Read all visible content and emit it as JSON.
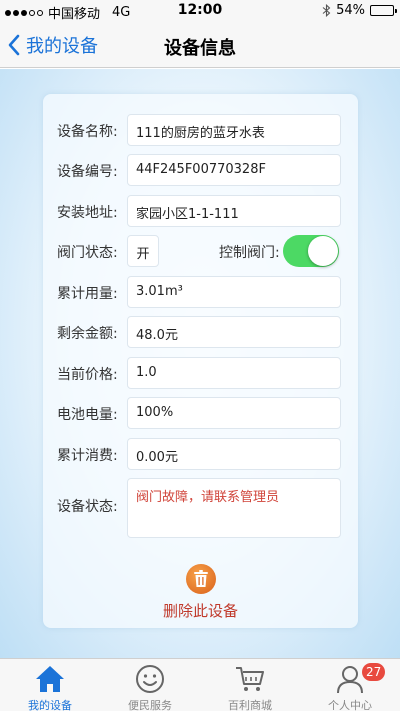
{
  "status_bar": {
    "carrier": "中国移动",
    "network": "4G",
    "time": "12:00",
    "battery_text": "54%",
    "battery_level": 0.54
  },
  "nav": {
    "back_label": "我的设备",
    "title": "设备信息"
  },
  "device": {
    "name_label": "设备名称:",
    "name_value": "111的厨房的蓝牙水表",
    "id_label": "设备编号:",
    "id_value": "44F245F00770328F",
    "address_label": "安装地址:",
    "address_value": "家园小区1-1-111",
    "valve_status_label": "阀门状态:",
    "valve_status_value": "开",
    "valve_control_label": "控制阀门:",
    "valve_control_on": true,
    "usage_label": "累计用量:",
    "usage_value": "3.01m³",
    "balance_label": "剩余金额:",
    "balance_value": "48.0元",
    "price_label": "当前价格:",
    "price_value": "1.0",
    "battery_label": "电池电量:",
    "battery_value": "100%",
    "consumption_label": "累计消费:",
    "consumption_value": "0.00元",
    "state_label": "设备状态:",
    "state_value": "阀门故障，请联系管理员"
  },
  "delete": {
    "label": "删除此设备",
    "icon": "trash-icon"
  },
  "tabs": [
    {
      "label": "我的设备",
      "icon": "home-icon",
      "active": true
    },
    {
      "label": "便民服务",
      "icon": "smiley-icon",
      "active": false
    },
    {
      "label": "百利商城",
      "icon": "cart-icon",
      "active": false
    },
    {
      "label": "个人中心",
      "icon": "user-icon",
      "active": false,
      "badge": "27"
    }
  ],
  "colors": {
    "accent": "#1b73d8",
    "toggle_on": "#4cd964",
    "danger": "#c0392b",
    "badge": "#e84a3f"
  }
}
